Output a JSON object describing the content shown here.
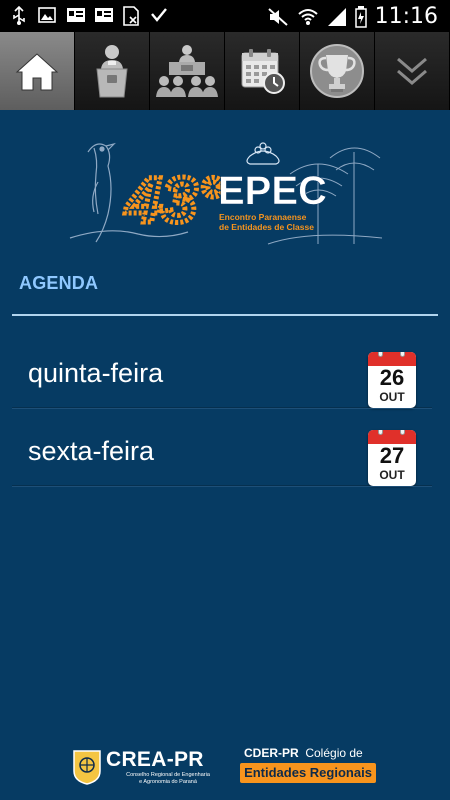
{
  "status_bar": {
    "time": "11:16",
    "icons": [
      "usb-icon",
      "image-icon",
      "contact-card-icon",
      "contact-card-icon",
      "sim-icon",
      "check-icon",
      "mute-icon",
      "wifi-icon",
      "signal-icon",
      "battery-icon"
    ]
  },
  "tabs": [
    {
      "icon": "home-icon",
      "active": true
    },
    {
      "icon": "speaker-podium-icon",
      "active": false
    },
    {
      "icon": "audience-icon",
      "active": false
    },
    {
      "icon": "calendar-clock-icon",
      "active": false
    },
    {
      "icon": "trophy-icon",
      "active": false
    },
    {
      "icon": "chevron-down-icon",
      "active": false
    }
  ],
  "banner": {
    "number": "43°",
    "title": "EPEC",
    "subtitle_line1": "Encontro Paranaense",
    "subtitle_line2": "de Entidades de Classe"
  },
  "agenda": {
    "label": "AGENDA",
    "days": [
      {
        "name": "quinta-feira",
        "day": "26",
        "month": "OUT"
      },
      {
        "name": "sexta-feira",
        "day": "27",
        "month": "OUT"
      }
    ]
  },
  "footer": {
    "crea_name": "CREA-PR",
    "crea_sub_line1": "Conselho Regional de Engenharia",
    "crea_sub_line2": "e Agronomia do Paraná",
    "cder_bold": "CDER-PR",
    "cder_rest": "Colégio de",
    "cder_box": "Entidades Regionais"
  },
  "colors": {
    "background": "#063b63",
    "agenda_label": "#8fc8ff",
    "calendar_red": "#e0302a",
    "orange": "#f7941d"
  }
}
